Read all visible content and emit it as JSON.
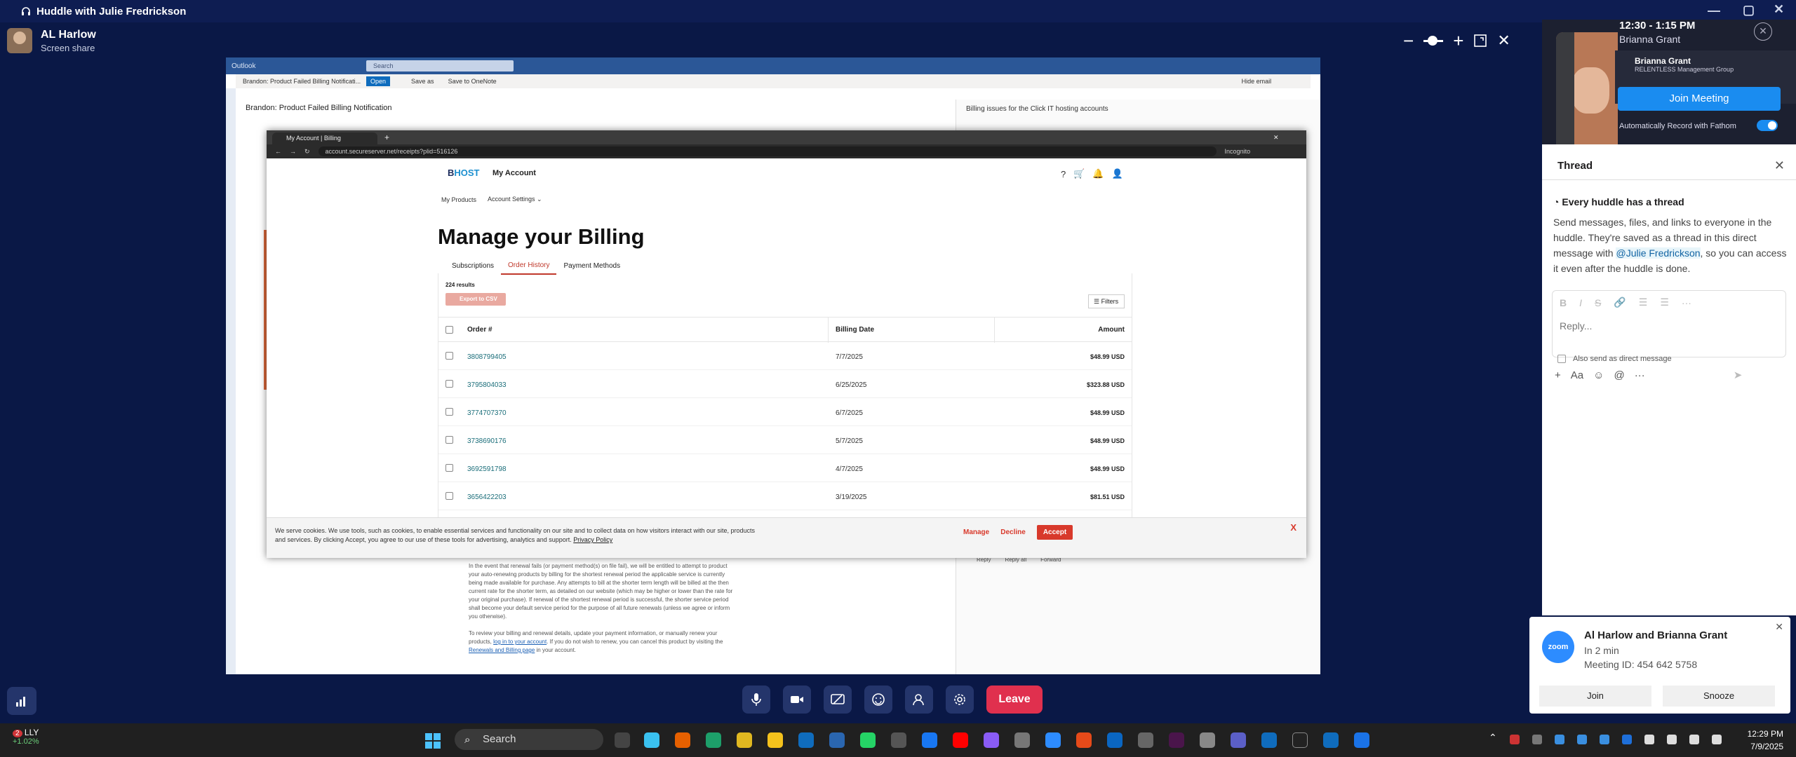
{
  "titlebar": {
    "title": "Huddle with Julie Fredrickson"
  },
  "presenter": {
    "name": "AL Harlow",
    "status": "Screen share"
  },
  "outlook": {
    "app": "Outlook",
    "search": "Search",
    "email_tab": "Brandon: Product Failed Billing Notificati...",
    "open_btn": "Open",
    "save_as": "Save as",
    "save_onenote": "Save to OneNote",
    "hide_email": "Hide email",
    "subject": "Brandon: Product Failed Billing Notification",
    "right_header": "Billing issues for the Click IT hosting accounts",
    "body_p1": "In the event that renewal fails (or payment method(s) on file fail), we will be entitled to attempt to product your auto-renewing products by billing for the shortest renewal period the applicable service is currently being made available for purchase. Any attempts to bill at the shorter term length will be billed at the then current rate for the shorter term, as detailed on our website (which may be higher or lower than the rate for your original purchase). If renewal of the shortest renewal period is successful, the shorter service period shall become your default service period for the purpose of all future renewals (unless we agree or inform you otherwise).",
    "body_p2a": "To review your billing and renewal details, update your payment information, or manually renew your products,",
    "body_link1": "log in to your account",
    "body_p2b": ". If you do not wish to renew, you can cancel this product by visiting the",
    "body_link2": "Renewals and Billing page",
    "body_p2c": "in your account.",
    "reply": "Reply",
    "reply_all": "Reply all",
    "forward": "Forward"
  },
  "chrome": {
    "tab_title": "My Account | Billing",
    "url": "account.secureserver.net/receipts?plid=516126",
    "incognito": "Incognito"
  },
  "billing": {
    "logo_prefix": "B",
    "logo_main": "HOST",
    "my_account": "My Account",
    "nav": [
      "My Products",
      "Account Settings ⌄"
    ],
    "title": "Manage your Billing",
    "tabs": [
      "Subscriptions",
      "Order History",
      "Payment Methods"
    ],
    "results": "224 results",
    "export": "Export to CSV",
    "filters": "Filters",
    "columns": {
      "order": "Order #",
      "date": "Billing Date",
      "amount": "Amount"
    },
    "rows": [
      {
        "order": "3808799405",
        "date": "7/7/2025",
        "amount": "$48.99 USD"
      },
      {
        "order": "3795804033",
        "date": "6/25/2025",
        "amount": "$323.88 USD"
      },
      {
        "order": "3774707370",
        "date": "6/7/2025",
        "amount": "$48.99 USD"
      },
      {
        "order": "3738690176",
        "date": "5/7/2025",
        "amount": "$48.99 USD"
      },
      {
        "order": "3692591798",
        "date": "4/7/2025",
        "amount": "$48.99 USD"
      },
      {
        "order": "3656422203",
        "date": "3/19/2025",
        "amount": "$81.51 USD"
      }
    ],
    "cookie_text": "We serve cookies. We use tools, such as cookies, to enable essential services and functionality on our site and to collect data on how visitors interact with our site, products and services. By clicking Accept, you agree to our use of these tools for advertising, analytics and support.",
    "privacy_link": "Privacy Policy",
    "manage": "Manage",
    "decline": "Decline",
    "accept": "Accept",
    "cookie_close": "X"
  },
  "toolbar": {
    "leave": "Leave"
  },
  "meeting": {
    "time": "12:30 - 1:15 PM",
    "host": "Brianna Grant",
    "card_name": "Brianna Grant",
    "card_org": "RELENTLESS Management Group",
    "join": "Join Meeting",
    "auto_record": "Automatically Record with Fathom"
  },
  "thread": {
    "title": "Thread",
    "heading": "Every huddle has a thread",
    "desc_a": "Send messages, files, and links to everyone in the huddle. They're saved as a thread in this direct message with",
    "mention": "@Julie Fredrickson",
    "desc_b": ", so you can access it even after the huddle is done.",
    "reply_placeholder": "Reply...",
    "also_send": "Also send as direct message"
  },
  "notification": {
    "app": "zoom",
    "title": "Al Harlow and Brianna Grant",
    "when": "In 2 min",
    "meeting_id": "Meeting ID: 454 642 5758",
    "join": "Join",
    "snooze": "Snooze"
  },
  "taskbar": {
    "stock_symbol": "LLY",
    "stock_change": "+1.02%",
    "stock_badge": "2",
    "search": "Search",
    "time": "12:29 PM",
    "date": "7/9/2025"
  }
}
